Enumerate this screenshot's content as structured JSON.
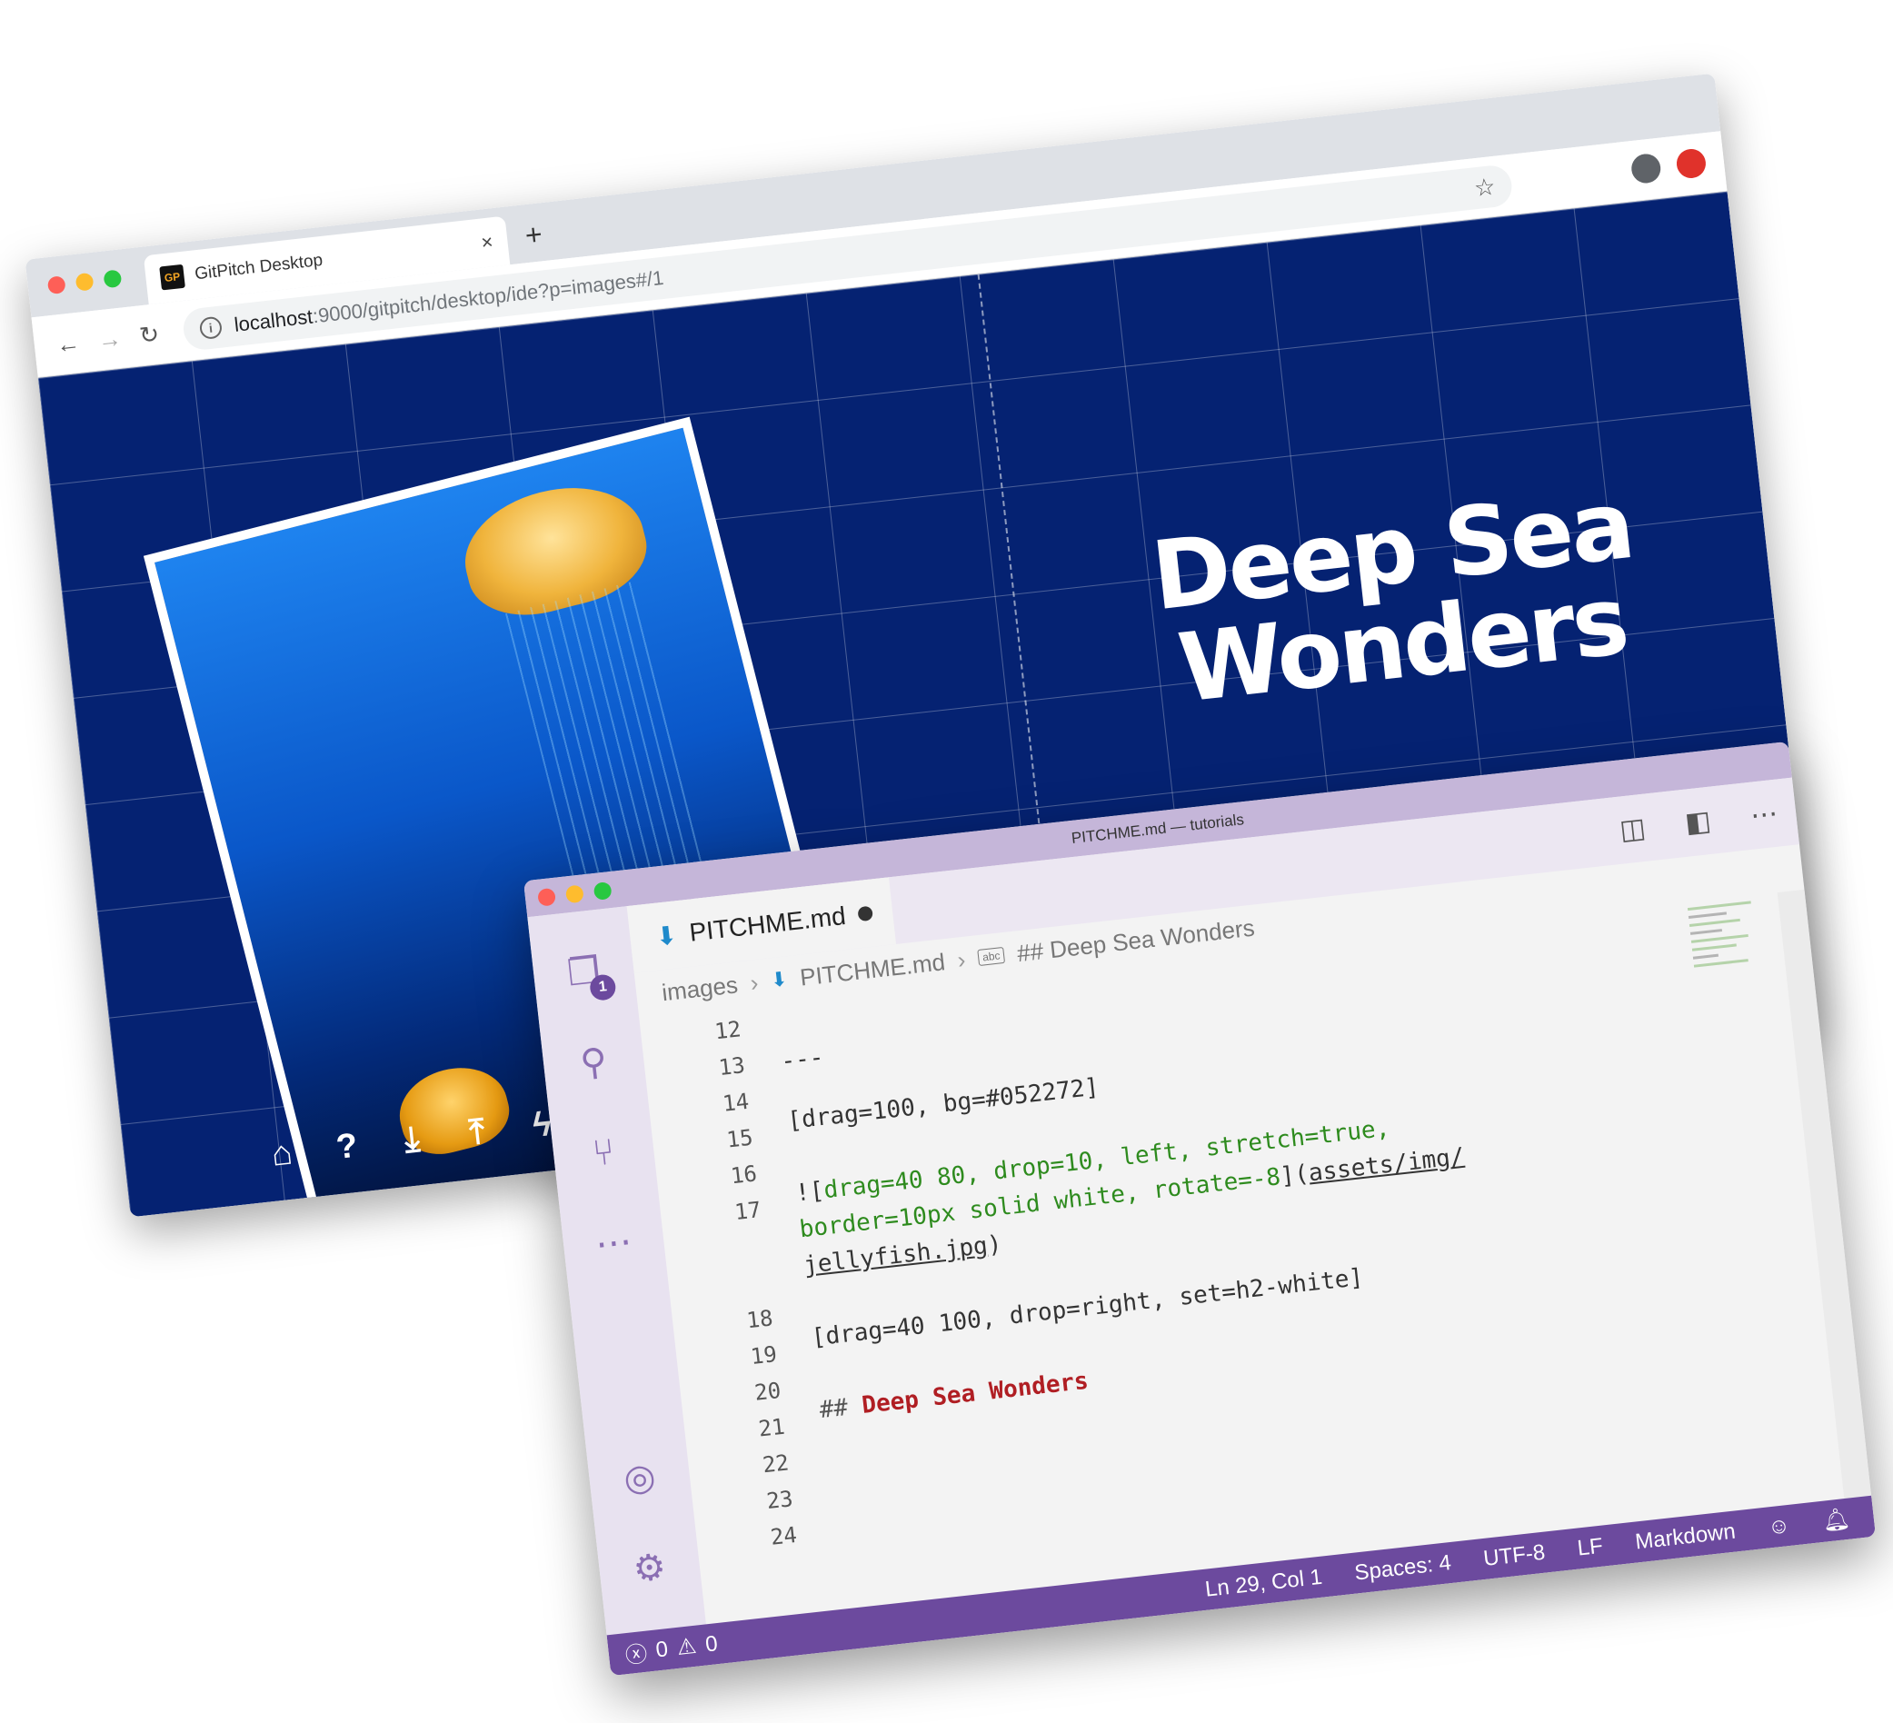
{
  "browser": {
    "tab_title": "GitPitch Desktop",
    "favicon_text": "GP",
    "tab_close": "×",
    "new_tab": "+",
    "nav": {
      "back": "←",
      "forward": "→",
      "reload": "↻"
    },
    "url_host": "localhost",
    "url_rest": ":9000/gitpitch/desktop/ide?p=images#/1",
    "bookmark_icon": "star-icon"
  },
  "slide": {
    "background_color": "#052272",
    "title_line1": "Deep Sea",
    "title_line2": "Wonders",
    "image_alt": "jellyfish",
    "toolbar_icons": [
      "home-icon",
      "help-icon",
      "download-icon",
      "upload-icon",
      "bolt-icon"
    ]
  },
  "vscode": {
    "window_title": "PITCHME.md — tutorials",
    "tab_name": "PITCHME.md",
    "explorer_badge": "1",
    "breadcrumb": {
      "folder": "images",
      "file": "PITCHME.md",
      "symbol_tag": "abc",
      "symbol": "## Deep Sea Wonders"
    },
    "lines": [
      {
        "n": "12",
        "text": ""
      },
      {
        "n": "13",
        "text": "---"
      },
      {
        "n": "14",
        "text": ""
      },
      {
        "n": "15",
        "text": "[drag=100, bg=#052272]"
      },
      {
        "n": "16",
        "text": ""
      },
      {
        "n": "17",
        "a": "![",
        "b": "drag=40 80, drop=10, left, stretch=true,",
        "c": "border=10px solid white, rotate=-8",
        "d": "](",
        "e": "assets/img/",
        "f": "jellyfish.jpg",
        "g": ")"
      },
      {
        "n": "18",
        "text": ""
      },
      {
        "n": "19",
        "text": "[drag=40 100, drop=right, set=h2-white]"
      },
      {
        "n": "20",
        "text": ""
      },
      {
        "n": "21",
        "hash": "## ",
        "heading": "Deep Sea Wonders"
      },
      {
        "n": "22",
        "text": ""
      },
      {
        "n": "23",
        "text": ""
      },
      {
        "n": "24",
        "text": ""
      }
    ],
    "status": {
      "errors": "0",
      "warnings": "0",
      "position": "Ln 29, Col 1",
      "spaces": "Spaces: 4",
      "encoding": "UTF-8",
      "eol": "LF",
      "language": "Markdown"
    },
    "accent_color": "#6c4a9e"
  }
}
